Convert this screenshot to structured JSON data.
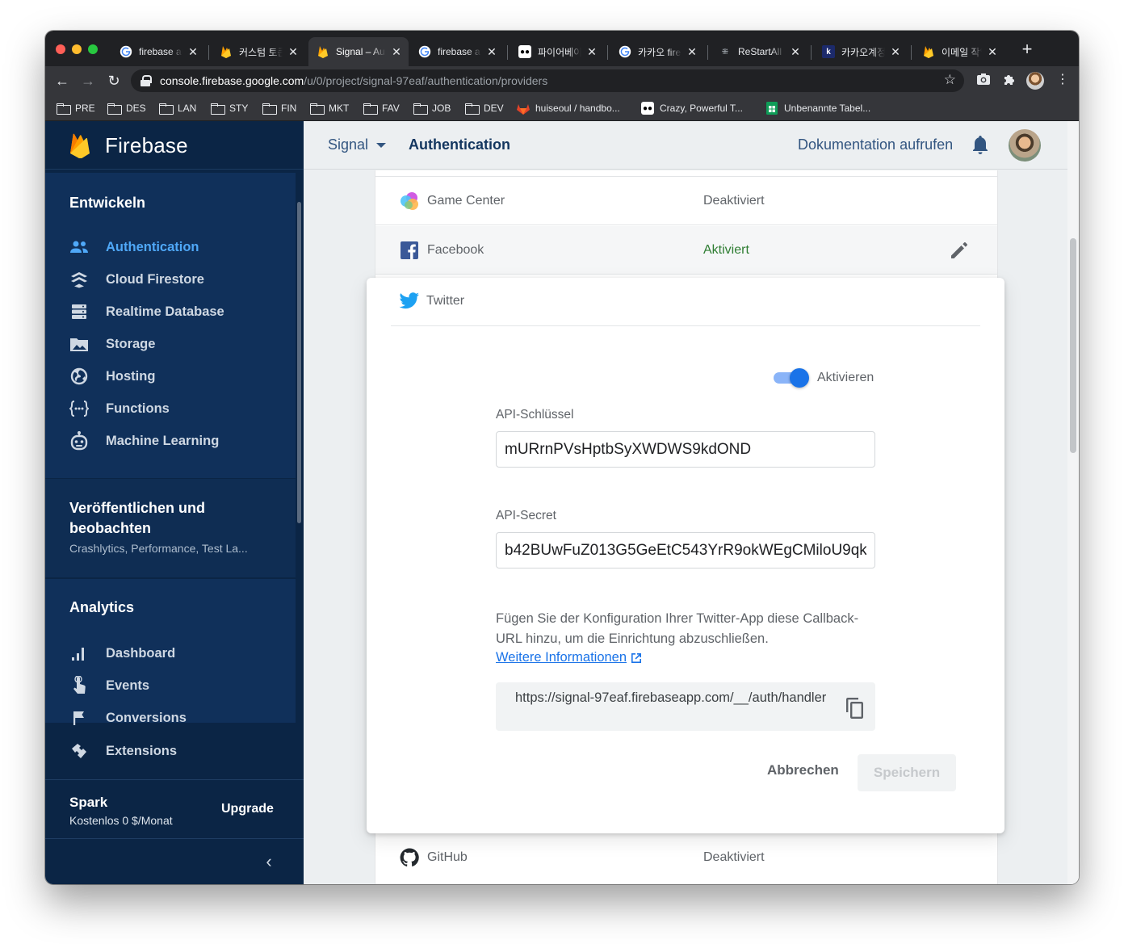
{
  "browser": {
    "tabs": [
      {
        "title": "firebase au",
        "icon": "google-icon"
      },
      {
        "title": "커스텀 토큰",
        "icon": "firebase-icon"
      },
      {
        "title": "Signal – Au",
        "icon": "firebase-icon",
        "active": true
      },
      {
        "title": "firebase au",
        "icon": "google-icon"
      },
      {
        "title": "파이어베이스",
        "icon": "medium-icon"
      },
      {
        "title": "카카오 fireb",
        "icon": "google-icon"
      },
      {
        "title": "ReStartAll",
        "icon": "restart-icon"
      },
      {
        "title": "카카오계정 ",
        "icon": "k-icon"
      },
      {
        "title": "이메일 작업",
        "icon": "firebase-icon"
      }
    ],
    "url_host": "console.firebase.google.com",
    "url_path": "/u/0/project/signal-97eaf/authentication/providers",
    "bookmarks": [
      {
        "label": "PRE",
        "type": "folder"
      },
      {
        "label": "DES",
        "type": "folder"
      },
      {
        "label": "LAN",
        "type": "folder"
      },
      {
        "label": "STY",
        "type": "folder"
      },
      {
        "label": "FIN",
        "type": "folder"
      },
      {
        "label": "MKT",
        "type": "folder"
      },
      {
        "label": "FAV",
        "type": "folder"
      },
      {
        "label": "JOB",
        "type": "folder"
      },
      {
        "label": "DEV",
        "type": "folder"
      },
      {
        "label": "huiseoul / handbo...",
        "type": "gitlab"
      },
      {
        "label": "Crazy, Powerful T...",
        "type": "medium"
      },
      {
        "label": "Unbenannte Tabel...",
        "type": "sheets"
      }
    ]
  },
  "sidebar": {
    "brand": "Firebase",
    "develop_title": "Entwickeln",
    "develop_items": [
      {
        "label": "Authentication",
        "icon": "people-icon",
        "active": true
      },
      {
        "label": "Cloud Firestore",
        "icon": "firestore-icon"
      },
      {
        "label": "Realtime Database",
        "icon": "database-icon"
      },
      {
        "label": "Storage",
        "icon": "image-icon"
      },
      {
        "label": "Hosting",
        "icon": "globe-icon"
      },
      {
        "label": "Functions",
        "icon": "functions-icon"
      },
      {
        "label": "Machine Learning",
        "icon": "robot-icon"
      }
    ],
    "release_title": "Veröffentlichen und beobachten",
    "release_sub": "Crashlytics, Performance, Test La...",
    "analytics_title": "Analytics",
    "analytics_items": [
      {
        "label": "Dashboard",
        "icon": "bar-chart-icon"
      },
      {
        "label": "Events",
        "icon": "touch-icon"
      },
      {
        "label": "Conversions",
        "icon": "flag-icon"
      }
    ],
    "extensions_label": "Extensions",
    "plan_name": "Spark",
    "plan_price": "Kostenlos 0 $/Monat",
    "upgrade_label": "Upgrade"
  },
  "header": {
    "project": "Signal",
    "page": "Authentication",
    "docs_link": "Dokumentation aufrufen"
  },
  "providers": {
    "game_center": {
      "name": "Game Center",
      "status": "Deaktiviert"
    },
    "facebook": {
      "name": "Facebook",
      "status": "Aktiviert"
    },
    "github": {
      "name": "GitHub",
      "status": "Deaktiviert"
    }
  },
  "twitter_panel": {
    "name": "Twitter",
    "toggle_label": "Aktivieren",
    "toggle_on": true,
    "api_key_label": "API-Schlüssel",
    "api_key_value": "mURrnPVsHptbSyXWDWS9kdOND",
    "api_secret_label": "API-Secret",
    "api_secret_value": "b42BUwFuZ013G5GeEtC543YrR9okWEgCMiloU9qk",
    "help_text": "Fügen Sie der Konfiguration Ihrer Twitter-App diese Callback-URL hinzu, um die Einrichtung abzuschließen.",
    "more_info_link": "Weitere Informationen",
    "callback_url": "https://signal-97eaf.firebaseapp.com/__/auth/handler",
    "cancel_label": "Abbrechen",
    "save_label": "Speichern"
  },
  "colors": {
    "sidebar_bg": "#0b2545",
    "active_accent": "#4fa8f8",
    "enabled_green": "#2e7d32",
    "toggle_blue": "#1a73e8"
  }
}
